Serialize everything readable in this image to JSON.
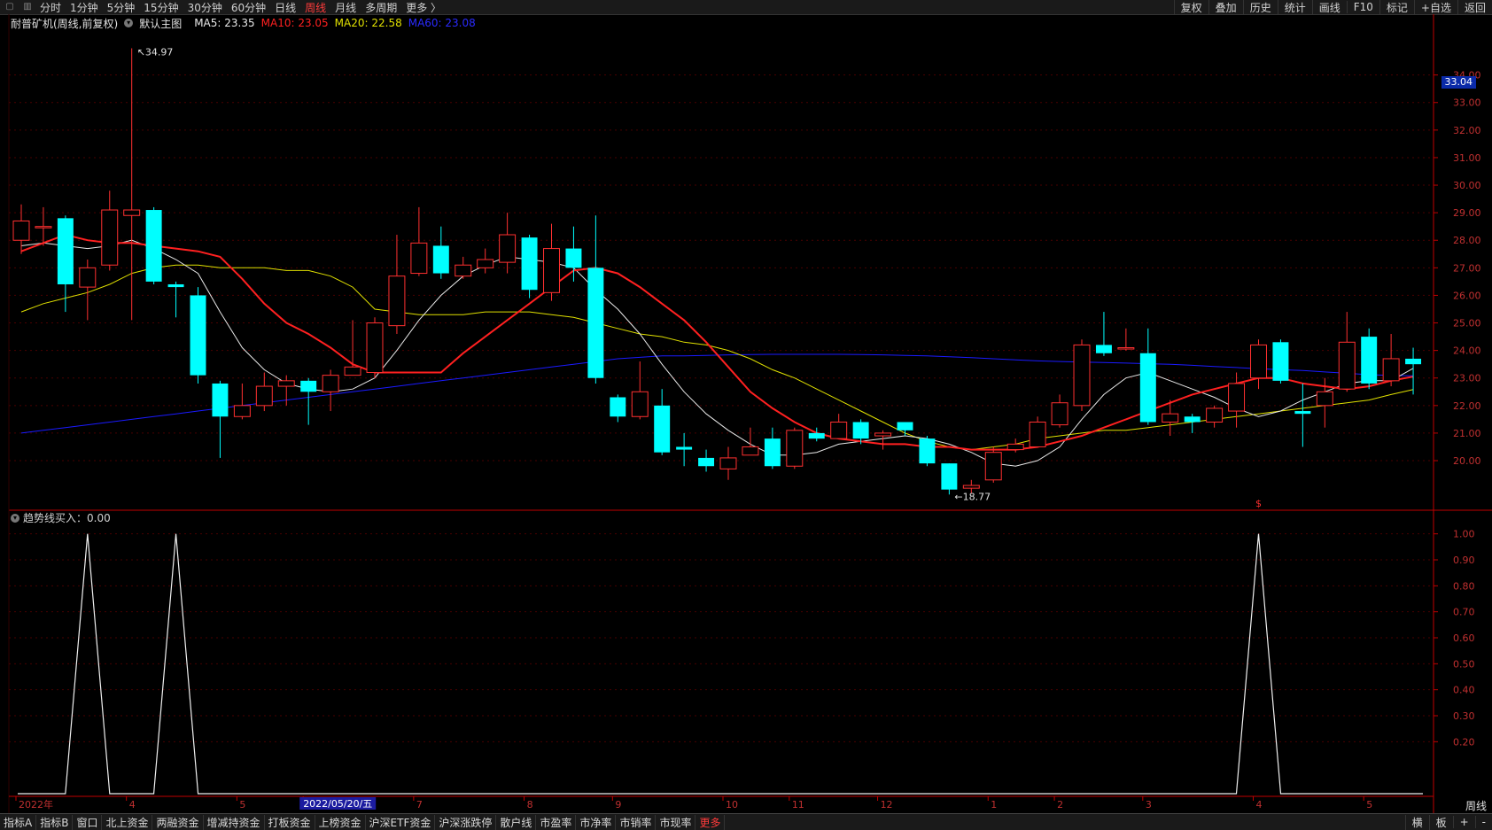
{
  "top_tabs": [
    {
      "label": "分时",
      "active": false
    },
    {
      "label": "1分钟",
      "active": false
    },
    {
      "label": "5分钟",
      "active": false
    },
    {
      "label": "15分钟",
      "active": false
    },
    {
      "label": "30分钟",
      "active": false
    },
    {
      "label": "60分钟",
      "active": false
    },
    {
      "label": "日线",
      "active": false
    },
    {
      "label": "周线",
      "active": true
    },
    {
      "label": "月线",
      "active": false
    },
    {
      "label": "多周期",
      "active": false
    },
    {
      "label": "更多 〉",
      "active": false
    }
  ],
  "top_right_tabs": [
    "复权",
    "叠加",
    "历史",
    "统计",
    "画线",
    "F10",
    "标记",
    "+自选",
    "返回"
  ],
  "info": {
    "stock": "耐普矿机(周线,前复权)",
    "main_chart": "默认主图",
    "ma5": "MA5: 23.35",
    "ma10": "MA10: 23.05",
    "ma20": "MA20: 22.58",
    "ma60": "MA60: 23.08"
  },
  "current_price_tag": "33.04",
  "indicator_label": "趋势线买入：0.00",
  "period_label": "周线",
  "bottom_tabs": [
    "指标A",
    "指标B",
    "窗口",
    "北上资金",
    "两融资金",
    "增减持资金",
    "打板资金",
    "上榜资金",
    "沪深ETF资金",
    "沪深涨跌停",
    "散户线",
    "市盈率",
    "市净率",
    "市销率",
    "市现率",
    "更多"
  ],
  "bottom_right_tabs": [
    "横",
    "板",
    "+",
    "-"
  ],
  "colors": {
    "up": "#ff3030",
    "down": "#00ffff",
    "ma5": "#e8e8e8",
    "ma10": "#ff2020",
    "ma20": "#e0e000",
    "ma60": "#1a1aff",
    "grid": "#4a0000",
    "axis": "#c00000"
  },
  "chart_data": {
    "type": "candlestick",
    "y_ticks": [
      "34.00",
      "33.00",
      "32.00",
      "31.00",
      "30.00",
      "29.00",
      "28.00",
      "27.00",
      "26.00",
      "25.00",
      "24.00",
      "23.00",
      "22.00",
      "21.00",
      "20.00"
    ],
    "ylim": [
      18.2,
      35.5
    ],
    "x_labels": [
      "2022年",
      "4",
      "5",
      "2022/05/20/五",
      "7",
      "8",
      "9",
      "10",
      "11",
      "12",
      "1",
      "2",
      "3",
      "4",
      "5"
    ],
    "annotations": {
      "high": "34.97",
      "low": "18.77",
      "marker": "$"
    },
    "candles": [
      [
        28.0,
        28.7,
        29.3,
        27.5
      ],
      [
        28.5,
        28.5,
        29.2,
        27.8
      ],
      [
        28.8,
        26.4,
        28.9,
        25.4
      ],
      [
        26.3,
        27.0,
        27.3,
        25.1
      ],
      [
        27.1,
        29.1,
        29.8,
        26.9
      ],
      [
        28.9,
        29.1,
        34.97,
        25.1
      ],
      [
        29.1,
        26.5,
        29.2,
        26.4
      ],
      [
        26.4,
        26.3,
        26.5,
        25.2
      ],
      [
        26.0,
        23.1,
        26.3,
        22.8
      ],
      [
        22.8,
        21.6,
        22.9,
        20.1
      ],
      [
        21.6,
        22.0,
        22.8,
        21.5
      ],
      [
        22.0,
        22.7,
        23.2,
        21.8
      ],
      [
        22.7,
        22.9,
        23.1,
        22.0
      ],
      [
        22.9,
        22.5,
        23.0,
        21.3
      ],
      [
        22.5,
        23.1,
        23.3,
        21.8
      ],
      [
        23.1,
        23.4,
        25.1,
        23.1
      ],
      [
        23.2,
        25.0,
        25.2,
        23.0
      ],
      [
        24.9,
        26.7,
        28.2,
        24.6
      ],
      [
        26.8,
        27.9,
        29.2,
        26.7
      ],
      [
        27.8,
        26.8,
        28.5,
        26.6
      ],
      [
        26.7,
        27.1,
        27.4,
        26.6
      ],
      [
        27.0,
        27.3,
        27.7,
        26.8
      ],
      [
        27.2,
        28.2,
        29.0,
        26.8
      ],
      [
        28.1,
        26.2,
        28.2,
        25.9
      ],
      [
        26.1,
        27.7,
        28.6,
        25.8
      ],
      [
        27.7,
        27.0,
        28.5,
        26.5
      ],
      [
        27.0,
        23.0,
        28.9,
        22.8
      ],
      [
        22.3,
        21.6,
        22.4,
        21.4
      ],
      [
        21.6,
        22.5,
        23.6,
        21.5
      ],
      [
        22.0,
        20.3,
        22.6,
        20.2
      ],
      [
        20.5,
        20.4,
        21.0,
        19.8
      ],
      [
        20.1,
        19.8,
        20.4,
        19.6
      ],
      [
        19.7,
        20.1,
        20.5,
        19.3
      ],
      [
        20.2,
        20.5,
        21.2,
        20.2
      ],
      [
        20.8,
        19.8,
        21.2,
        19.7
      ],
      [
        19.8,
        21.1,
        21.2,
        19.7
      ],
      [
        21.0,
        20.8,
        21.2,
        20.7
      ],
      [
        20.8,
        21.4,
        21.7,
        20.8
      ],
      [
        21.4,
        20.8,
        21.5,
        20.6
      ],
      [
        20.9,
        21.0,
        21.1,
        20.4
      ],
      [
        21.4,
        21.1,
        21.4,
        20.9
      ],
      [
        20.8,
        19.9,
        20.9,
        19.8
      ],
      [
        19.9,
        18.95,
        19.9,
        18.77
      ],
      [
        19.0,
        19.1,
        19.3,
        18.8
      ],
      [
        19.3,
        20.3,
        20.5,
        19.2
      ],
      [
        20.4,
        20.6,
        20.8,
        20.3
      ],
      [
        20.5,
        21.4,
        21.6,
        20.5
      ],
      [
        21.3,
        22.1,
        22.4,
        21.2
      ],
      [
        22.0,
        24.2,
        24.4,
        21.8
      ],
      [
        24.2,
        23.9,
        25.4,
        23.8
      ],
      [
        24.1,
        24.1,
        24.8,
        24.0
      ],
      [
        23.9,
        21.4,
        24.8,
        21.3
      ],
      [
        21.4,
        21.7,
        22.2,
        20.9
      ],
      [
        21.6,
        21.4,
        21.7,
        21.0
      ],
      [
        21.4,
        21.9,
        22.0,
        21.2
      ],
      [
        21.8,
        22.8,
        23.2,
        21.2
      ],
      [
        23.0,
        24.2,
        24.4,
        22.6
      ],
      [
        24.3,
        22.9,
        24.4,
        22.8
      ],
      [
        21.8,
        21.7,
        22.8,
        20.5
      ],
      [
        22.0,
        22.5,
        23.0,
        21.2
      ],
      [
        22.6,
        24.3,
        25.4,
        22.5
      ],
      [
        24.5,
        22.8,
        24.8,
        22.6
      ],
      [
        22.9,
        23.7,
        24.6,
        22.7
      ],
      [
        23.7,
        23.5,
        24.1,
        22.4
      ]
    ],
    "ma5": [
      27.8,
      27.9,
      27.8,
      27.7,
      27.8,
      28.0,
      27.7,
      27.3,
      26.8,
      25.4,
      24.1,
      23.3,
      22.8,
      22.6,
      22.5,
      22.6,
      23.0,
      24.0,
      25.1,
      26.0,
      26.7,
      27.1,
      27.4,
      27.3,
      27.2,
      27.0,
      26.2,
      25.5,
      24.6,
      23.5,
      22.5,
      21.7,
      21.1,
      20.6,
      20.2,
      20.2,
      20.3,
      20.6,
      20.7,
      20.8,
      20.9,
      20.8,
      20.6,
      20.3,
      19.9,
      19.8,
      20.0,
      20.5,
      21.5,
      22.4,
      23.0,
      23.2,
      22.9,
      22.6,
      22.3,
      21.9,
      21.6,
      21.8,
      22.2,
      22.5,
      22.8,
      22.9,
      22.9,
      23.35
    ],
    "ma10": [
      27.6,
      27.9,
      28.2,
      28.0,
      27.9,
      27.9,
      27.8,
      27.7,
      27.6,
      27.4,
      26.6,
      25.7,
      25.0,
      24.6,
      24.1,
      23.5,
      23.2,
      23.2,
      23.2,
      23.2,
      23.9,
      24.5,
      25.1,
      25.7,
      26.3,
      26.9,
      27.0,
      26.8,
      26.3,
      25.7,
      25.1,
      24.3,
      23.4,
      22.5,
      21.9,
      21.4,
      21.0,
      20.8,
      20.7,
      20.6,
      20.6,
      20.5,
      20.5,
      20.4,
      20.4,
      20.4,
      20.5,
      20.7,
      20.9,
      21.2,
      21.5,
      21.8,
      22.1,
      22.4,
      22.6,
      22.8,
      23.0,
      23.0,
      22.8,
      22.7,
      22.6,
      22.7,
      22.9,
      23.05
    ],
    "ma20": [
      25.4,
      25.7,
      25.9,
      26.1,
      26.4,
      26.8,
      27.0,
      27.1,
      27.1,
      27.0,
      27.0,
      27.0,
      26.9,
      26.9,
      26.7,
      26.3,
      25.5,
      25.4,
      25.3,
      25.3,
      25.3,
      25.4,
      25.4,
      25.4,
      25.3,
      25.2,
      25.0,
      24.8,
      24.6,
      24.5,
      24.3,
      24.2,
      24.0,
      23.7,
      23.3,
      23.0,
      22.6,
      22.2,
      21.8,
      21.4,
      21.0,
      20.7,
      20.5,
      20.4,
      20.5,
      20.6,
      20.8,
      20.9,
      21.0,
      21.1,
      21.1,
      21.2,
      21.3,
      21.4,
      21.5,
      21.6,
      21.7,
      21.8,
      21.9,
      22.0,
      22.1,
      22.2,
      22.4,
      22.58
    ],
    "ma60": [
      21.0,
      21.1,
      21.2,
      21.3,
      21.4,
      21.5,
      21.6,
      21.7,
      21.8,
      21.9,
      22.0,
      22.1,
      22.2,
      22.3,
      22.4,
      22.5,
      22.6,
      22.7,
      22.8,
      22.9,
      23.0,
      23.1,
      23.2,
      23.3,
      23.4,
      23.5,
      23.6,
      23.7,
      23.75,
      23.8,
      23.8,
      23.82,
      23.84,
      23.85,
      23.86,
      23.86,
      23.86,
      23.86,
      23.85,
      23.84,
      23.82,
      23.8,
      23.77,
      23.74,
      23.7,
      23.66,
      23.62,
      23.6,
      23.58,
      23.56,
      23.54,
      23.52,
      23.5,
      23.46,
      23.42,
      23.38,
      23.34,
      23.3,
      23.27,
      23.22,
      23.17,
      23.12,
      23.09,
      23.08
    ],
    "indicator": {
      "name": "趋势线买入",
      "y_ticks": [
        "1.00",
        "0.90",
        "0.80",
        "0.70",
        "0.60",
        "0.50",
        "0.40",
        "0.30",
        "0.20"
      ],
      "ylim": [
        0,
        1.05
      ],
      "spikes_at_index": [
        3,
        7,
        56
      ]
    }
  }
}
